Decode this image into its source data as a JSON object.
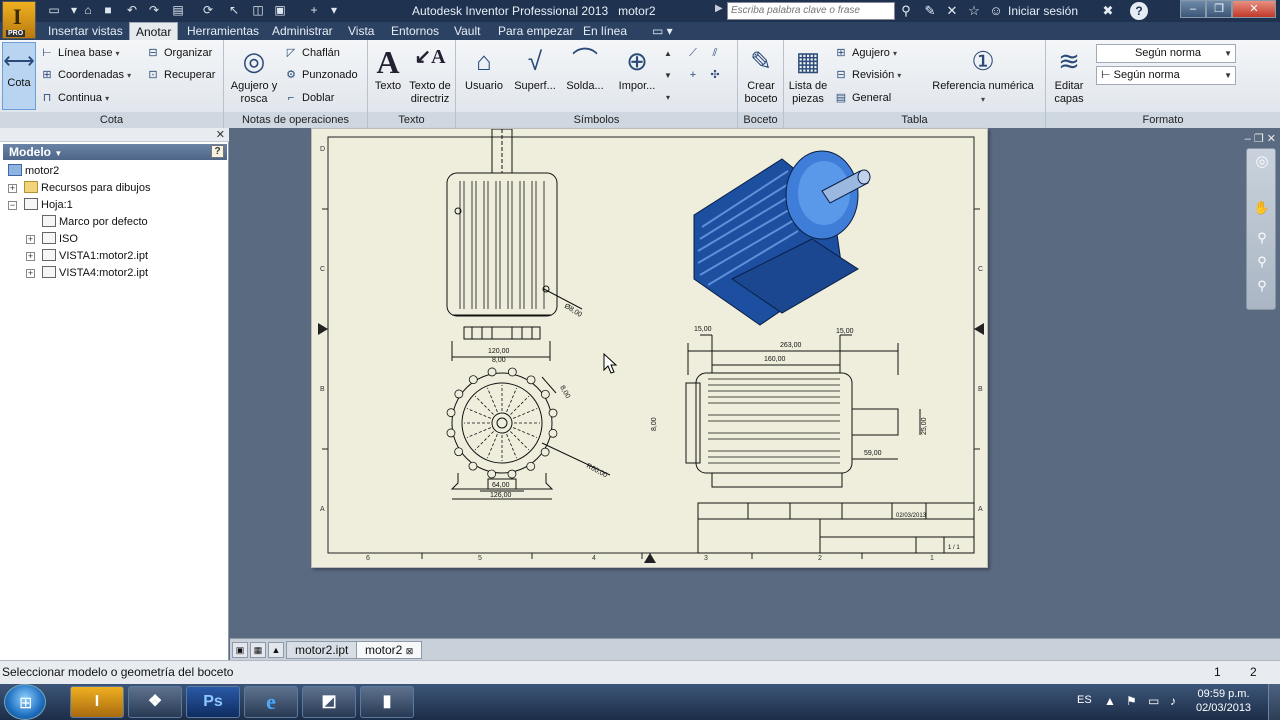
{
  "window": {
    "title": "Autodesk Inventor Professional 2013",
    "document": "motor2",
    "search_placeholder": "Escriba palabra clave o frase",
    "signin": "Iniciar sesión",
    "help": "?"
  },
  "menu": [
    "Insertar vistas",
    "Anotar",
    "Herramientas",
    "Administrar",
    "Vista",
    "Entornos",
    "Vault",
    "Para empezar",
    "En línea"
  ],
  "menu_active": "Anotar",
  "ribbon": {
    "cota": {
      "label": "Cota",
      "big": "Cota",
      "linea_base": "Línea base",
      "coordenadas": "Coordenadas",
      "continua": "Continua",
      "organizar": "Organizar",
      "recuperar": "Recuperar"
    },
    "notas": {
      "label": "Notas de operaciones",
      "agujero": "Agujero y",
      "agujero2": "rosca",
      "chaflan": "Chaflán",
      "punzonado": "Punzonado",
      "doblar": "Doblar"
    },
    "texto": {
      "label": "Texto",
      "texto": "Texto",
      "directriz1": "Texto de",
      "directriz2": "directriz"
    },
    "simbolos": {
      "label": "Símbolos",
      "usuario": "Usuario",
      "superf": "Superf...",
      "solda": "Solda...",
      "impor": "Impor..."
    },
    "boceto": {
      "label": "Boceto",
      "crear1": "Crear",
      "crear2": "boceto"
    },
    "tabla": {
      "label": "Tabla",
      "lista1": "Lista de",
      "lista2": "piezas",
      "agujero": "Agujero",
      "revision": "Revisión",
      "general": "General",
      "referencia": "Referencia numérica"
    },
    "formato": {
      "label": "Formato",
      "editar1": "Editar",
      "editar2": "capas",
      "style1": "Según norma",
      "style2": "Según norma"
    }
  },
  "browser": {
    "title": "Modelo",
    "help": "?",
    "items": [
      "motor2",
      "Recursos para dibujos",
      "Hoja:1",
      "Marco por defecto",
      "ISO",
      "VISTA1:motor2.ipt",
      "VISTA4:motor2.ipt"
    ]
  },
  "drawing": {
    "row_labels": [
      "D",
      "C",
      "B",
      "A"
    ],
    "col_labels": [
      "6",
      "5",
      "4",
      "3",
      "2",
      "1"
    ],
    "dims": {
      "d120": "120,00",
      "d8a": "8,00",
      "d28": "Ø8,00",
      "d8b": "8,00",
      "r60": "R60,00",
      "d64": "64,00",
      "d126": "126,00",
      "d15a": "15,00",
      "d15b": "15,00",
      "d263": "263,00",
      "d160": "160,00",
      "d8c": "8,00",
      "d25": "25,00",
      "d59": "59,00"
    },
    "titleblock": {
      "date": "02/03/2013",
      "sheet": "1 / 1"
    }
  },
  "doc_tabs": [
    "motor2.ipt",
    "motor2"
  ],
  "doc_tab_active": "motor2",
  "status": {
    "message": "Seleccionar modelo o geometría del boceto",
    "n1": "1",
    "n2": "2"
  },
  "taskbar": {
    "lang": "ES",
    "time": "09:59 p.m.",
    "date": "02/03/2013",
    "apps": [
      "Inventor",
      "Explorador",
      "Ps",
      "e",
      "Media",
      "Proyector"
    ]
  },
  "colors": {
    "title_bar": "#1f3350",
    "ribbon": "#e6eaef",
    "canvas": "#5a6a80",
    "sheet": "#efeedd",
    "motor_blue": "#1c4fa0"
  }
}
